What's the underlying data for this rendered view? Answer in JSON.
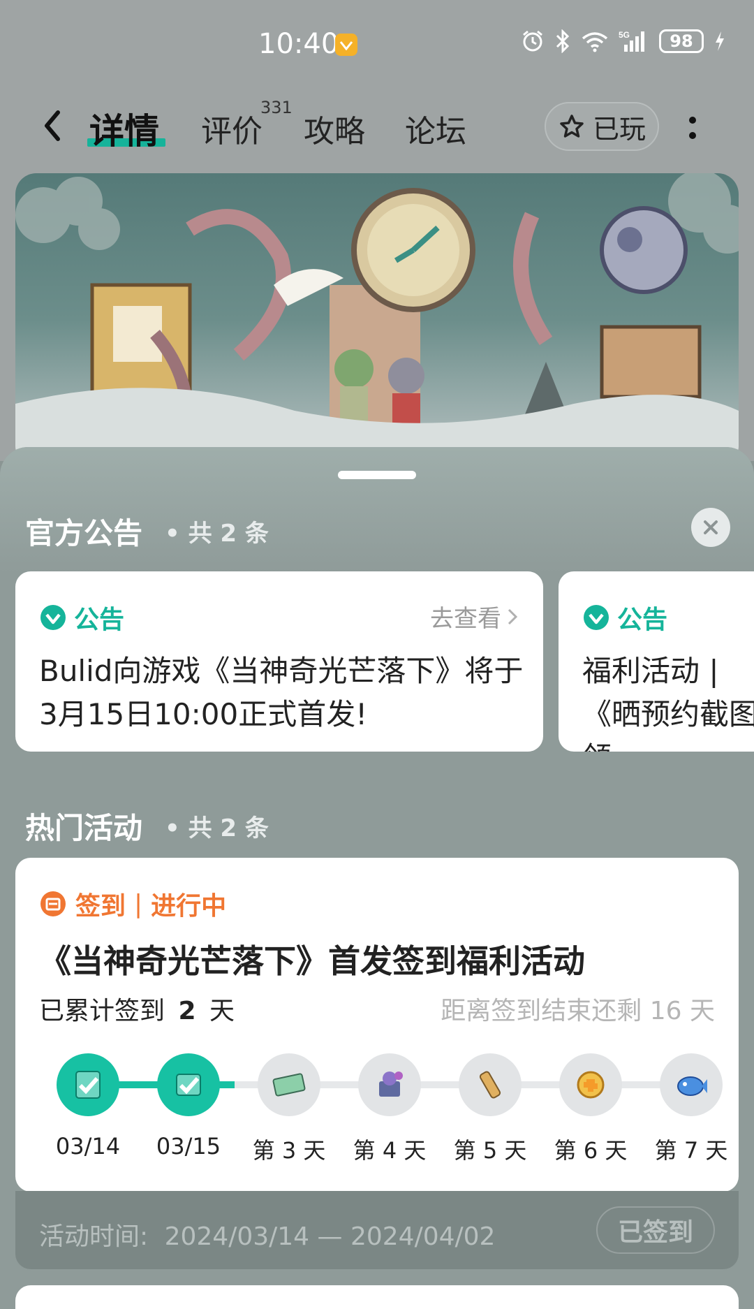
{
  "status_bar": {
    "time": "10:40",
    "battery": "98",
    "network": "5G"
  },
  "nav": {
    "tabs": [
      {
        "label": "详情",
        "active": true
      },
      {
        "label": "评价",
        "count": "331"
      },
      {
        "label": "攻略"
      },
      {
        "label": "论坛"
      }
    ],
    "played_label": "已玩"
  },
  "announcements": {
    "title": "官方公告",
    "count": "• 共 2 条",
    "items": [
      {
        "tag": "公告",
        "link": "去查看",
        "text": "Bulid向游戏《当神奇光芒落下》将于3月15日10:00正式首发!"
      },
      {
        "tag": "公告",
        "text": "福利活动 | 《晒预约截图领"
      }
    ]
  },
  "activities": {
    "title": "热门活动",
    "count": "• 共 2 条",
    "card": {
      "tag_type": "签到",
      "tag_status": "进行中",
      "title": "《当神奇光芒落下》首发签到福利活动",
      "signed_prefix": "已累计签到",
      "signed_days": "2",
      "signed_suffix": "天",
      "remaining": "距离签到结束还剩 16 天",
      "days": [
        {
          "label": "03/14",
          "done": true
        },
        {
          "label": "03/15",
          "done": true
        },
        {
          "label": "第 3 天",
          "done": false
        },
        {
          "label": "第 4 天",
          "done": false
        },
        {
          "label": "第 5 天",
          "done": false
        },
        {
          "label": "第 6 天",
          "done": false
        },
        {
          "label": "第 7 天",
          "done": false
        }
      ],
      "time_label": "活动时间:",
      "time_range": "2024/03/14 — 2024/04/02",
      "button": "已签到"
    }
  },
  "colors": {
    "accent": "#16b39a",
    "activity_orange": "#f07632"
  }
}
